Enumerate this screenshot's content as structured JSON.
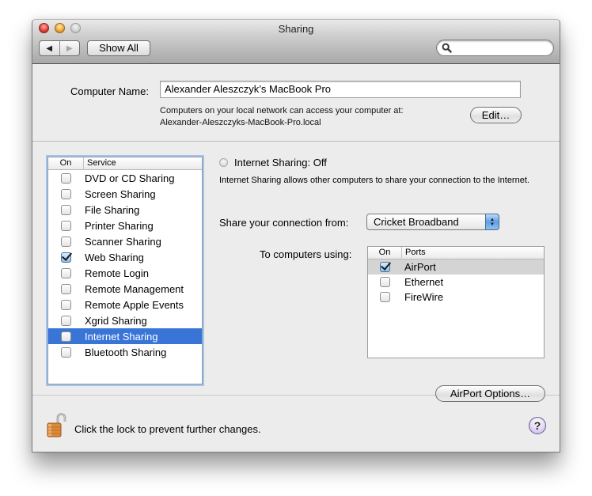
{
  "window": {
    "title": "Sharing",
    "toolbar": {
      "back_icon": "◀",
      "forward_icon": "▶",
      "show_all_label": "Show All",
      "search_placeholder": "",
      "search_value": ""
    }
  },
  "computer_name": {
    "label": "Computer Name:",
    "value": "Alexander Aleszczyk’s MacBook Pro",
    "note_line1": "Computers on your local network can access your computer at:",
    "note_line2": "Alexander-Aleszczyks-MacBook-Pro.local",
    "edit_label": "Edit…"
  },
  "services": {
    "header_on": "On",
    "header_service": "Service",
    "items": [
      {
        "label": "DVD or CD Sharing",
        "checked": false,
        "selected": false
      },
      {
        "label": "Screen Sharing",
        "checked": false,
        "selected": false
      },
      {
        "label": "File Sharing",
        "checked": false,
        "selected": false
      },
      {
        "label": "Printer Sharing",
        "checked": false,
        "selected": false
      },
      {
        "label": "Scanner Sharing",
        "checked": false,
        "selected": false
      },
      {
        "label": "Web Sharing",
        "checked": true,
        "selected": false
      },
      {
        "label": "Remote Login",
        "checked": false,
        "selected": false
      },
      {
        "label": "Remote Management",
        "checked": false,
        "selected": false
      },
      {
        "label": "Remote Apple Events",
        "checked": false,
        "selected": false
      },
      {
        "label": "Xgrid Sharing",
        "checked": false,
        "selected": false
      },
      {
        "label": "Internet Sharing",
        "checked": false,
        "selected": true
      },
      {
        "label": "Bluetooth Sharing",
        "checked": false,
        "selected": false
      }
    ]
  },
  "detail": {
    "status": "Internet Sharing: Off",
    "description": "Internet Sharing allows other computers to share your connection to the Internet.",
    "share_from_label": "Share your connection from:",
    "share_from_value": "Cricket Broadband",
    "to_computers_label": "To computers using:",
    "ports_header_on": "On",
    "ports_header_ports": "Ports",
    "ports": [
      {
        "label": "AirPort",
        "checked": true,
        "highlighted": true
      },
      {
        "label": "Ethernet",
        "checked": false,
        "highlighted": false
      },
      {
        "label": "FireWire",
        "checked": false,
        "highlighted": false
      }
    ],
    "airport_options_label": "AirPort Options…"
  },
  "footer": {
    "lock_text": "Click the lock to prevent further changes.",
    "lock_state": "unlocked",
    "help_label": "?"
  },
  "colors": {
    "selection": "#3875d7",
    "window_bg": "#ececec"
  }
}
